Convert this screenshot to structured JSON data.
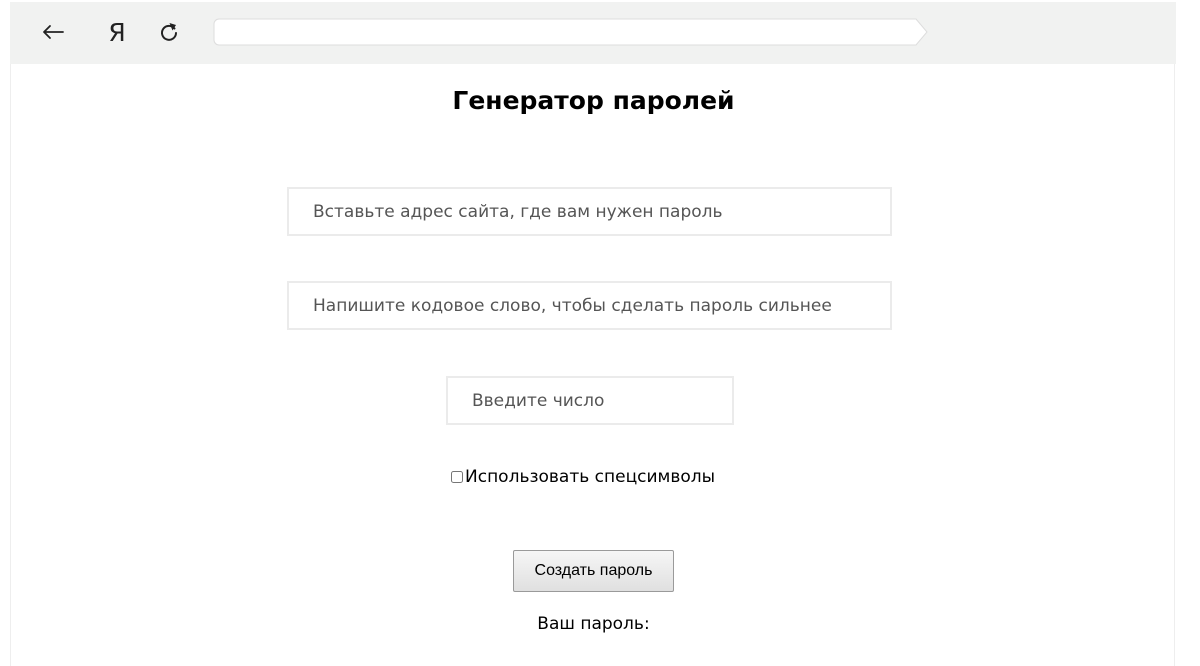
{
  "browser": {
    "back_icon": "arrow-left-icon",
    "logo_text": "Я",
    "reload_icon": "reload-icon",
    "address": ""
  },
  "form": {
    "title": "Генератор паролей",
    "site_placeholder": "Вставьте адрес сайта, где вам нужен пароль",
    "codeword_placeholder": "Напишите кодовое слово, чтобы сделать пароль сильнее",
    "number_placeholder": "Введите число",
    "special_chars_label": "Использовать спецсимволы",
    "special_chars_checked": false,
    "create_button_label": "Создать пароль",
    "result_label": "Ваш пароль:"
  }
}
